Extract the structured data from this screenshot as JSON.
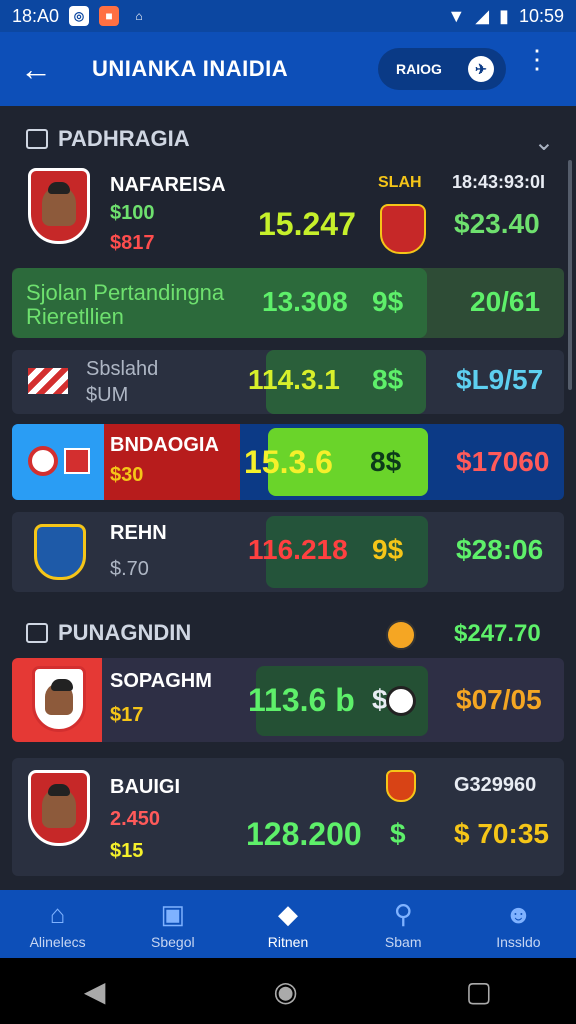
{
  "status": {
    "left_time": "18:A0",
    "right_time": "10:59"
  },
  "appbar": {
    "title": "UNIANKA INAIDIA",
    "pill_label": "RAIOG"
  },
  "section1": {
    "title": "PADHRAGIA"
  },
  "section2": {
    "title": "PUNAGNDIN"
  },
  "rows": [
    {
      "name": "NAFAREISA",
      "sub1": "$100",
      "sub2": "$817",
      "score": "15.247",
      "tag": "SLAH",
      "right_top": "18:43:93:0I",
      "right_value": "$23.40"
    },
    {
      "line1": "Sjolan Pertandingna",
      "line2": "Rieretllien",
      "score": "13.308",
      "mid": "9$",
      "right_value": "20/61"
    },
    {
      "name": "Sbslahd",
      "sub1": "$UM",
      "score": "114.3.1",
      "mid": "8$",
      "right_value": "$L9/57"
    },
    {
      "name": "BNDAOGIA",
      "sub1": "$30",
      "score": "15.3.6",
      "mid": "8$",
      "right_value": "$17060"
    },
    {
      "name": "REHN",
      "sub1": "$.70",
      "score": "116.218",
      "mid": "9$",
      "right_value": "$28:06"
    },
    {
      "name": "SOPAGHM",
      "sub1": "$17",
      "score": "113.6 b",
      "mid": "$",
      "right_top": "$247.70",
      "right_value": "$07/05"
    },
    {
      "name": "BAUIGI",
      "sub1": "2.450",
      "sub2": "$15",
      "score": "128.200",
      "mid": "$",
      "right_top": "G329960",
      "right_value": "$ 70:35"
    }
  ],
  "nav": [
    {
      "label": "Alinelecs",
      "icon": "home-icon"
    },
    {
      "label": "Sbegol",
      "icon": "wallet-icon"
    },
    {
      "label": "Ritnen",
      "icon": "chart-icon"
    },
    {
      "label": "Sbam",
      "icon": "search-icon"
    },
    {
      "label": "Inssldo",
      "icon": "profile-icon"
    }
  ]
}
